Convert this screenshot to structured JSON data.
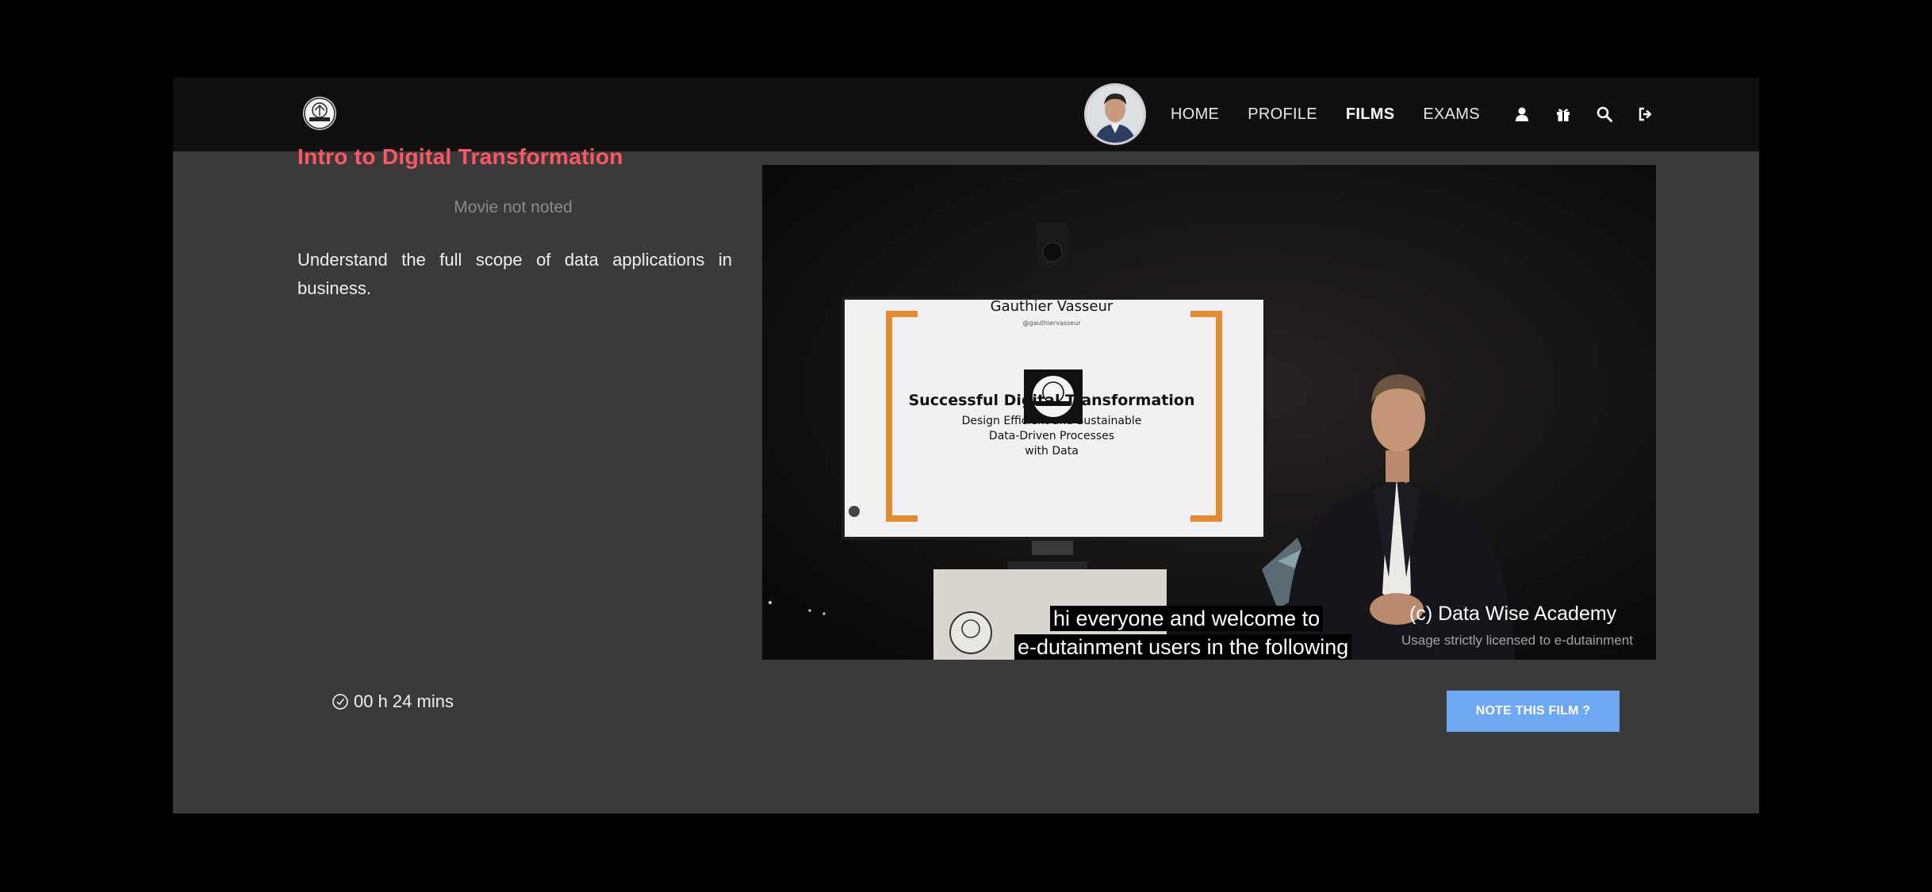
{
  "header": {
    "logo_icon": "academy-logo-icon",
    "avatar_icon": "user-avatar",
    "nav": [
      {
        "label": "HOME",
        "active": false
      },
      {
        "label": "PROFILE",
        "active": false
      },
      {
        "label": "FILMS",
        "active": true
      },
      {
        "label": "EXAMS",
        "active": false
      }
    ],
    "icons": [
      "user-icon",
      "gift-icon",
      "search-icon",
      "sign-out-icon"
    ]
  },
  "film": {
    "title": "Intro to Digital Transformation",
    "rating_status": "Movie not noted",
    "description": "Understand the full scope of data applications in business.",
    "duration": "00 h 24 mins",
    "rate_button_label": "NOTE THIS FILM ?"
  },
  "video": {
    "slide": {
      "presenter": "Gauthier Vasseur",
      "handle": "@gauthiervasseur",
      "title": "Successful Digital Transformation",
      "subtitle": "Design Efficient and Sustainable\nData-Driven Processes\nwith Data"
    },
    "captions": [
      "hi everyone and welcome to",
      "e-dutainment users in the following"
    ],
    "watermark": "(c) Data Wise Academy",
    "license_note": "Usage strictly licensed to e-dutainment"
  },
  "colors": {
    "accent_title": "#ff5663",
    "button": "#6ea8f2",
    "page_bg": "#3a3a3a",
    "header_bg": "#101010"
  }
}
